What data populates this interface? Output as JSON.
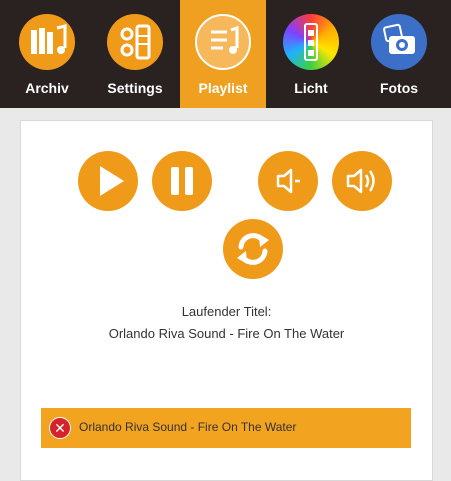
{
  "tabs": [
    {
      "label": "Archiv",
      "icon": "archive-music-icon",
      "active": false
    },
    {
      "label": "Settings",
      "icon": "settings-sliders-icon",
      "active": false
    },
    {
      "label": "Playlist",
      "icon": "playlist-icon",
      "active": true
    },
    {
      "label": "Licht",
      "icon": "light-color-icon",
      "active": false
    },
    {
      "label": "Fotos",
      "icon": "photo-camera-icon",
      "active": false
    }
  ],
  "controls": {
    "play": "play-icon",
    "pause": "pause-icon",
    "volume_down": "volume-down-icon",
    "volume_up": "volume-up-icon",
    "refresh": "refresh-icon"
  },
  "now_playing": {
    "label": "Laufender Titel:",
    "title": "Orlando Riva Sound - Fire On The Water"
  },
  "playlist": [
    {
      "title": "Orlando Riva Sound - Fire On The Water"
    }
  ],
  "colors": {
    "accent": "#f09a1a",
    "tabbar": "#2a2220",
    "remove": "#d6222a"
  }
}
